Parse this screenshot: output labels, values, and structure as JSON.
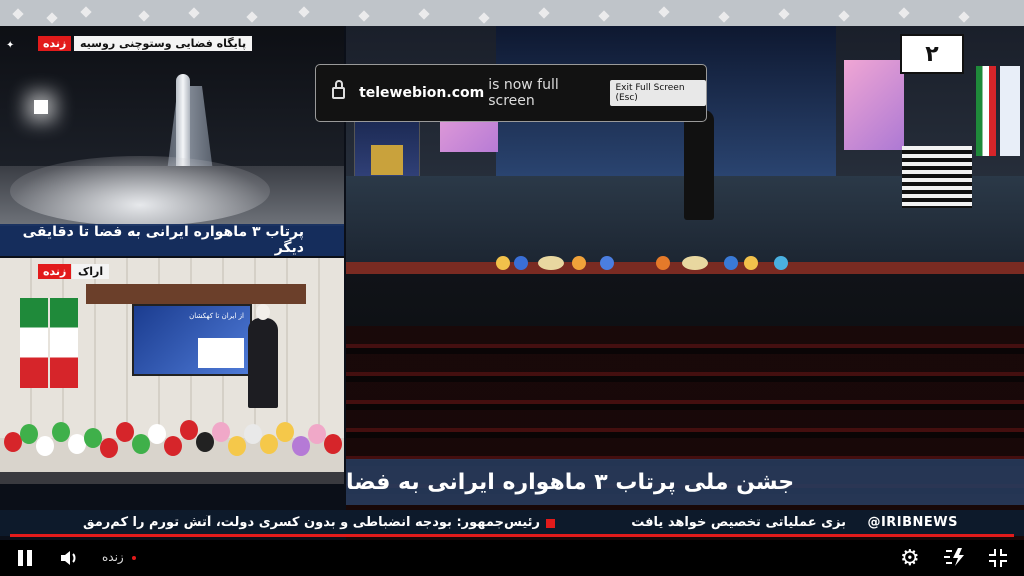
{
  "fullscreen_toast": {
    "domain": "telewebion.com",
    "message": "is now full screen",
    "exit_label": "Exit Full Screen (Esc)"
  },
  "panel_top": {
    "location_label": "پایگاه فضایی وستوچنی روسیه",
    "live_label": "زنده",
    "caption": "پرتاب ۳ ماهواره ایرانی به فضا تا دقایقی دیگر"
  },
  "panel_bottom": {
    "location_label": "اراک",
    "live_label": "زنده",
    "screen_text": "از ایران تا کهکشان"
  },
  "channel_logo": "۲",
  "lower_third": "جشن ملی پرتاب ۳ ماهواره ایرانی به فضا",
  "ticker": {
    "brand": "@IRIBNEWS",
    "item1": "بزی عملیاتی تخصیص خواهد یافت",
    "item2": "رئیس‌جمهور: بودجه انضباطی و بدون کسری دولت، آتش تورم را کم‌رمق"
  },
  "player": {
    "live_label": "زنده",
    "icons": [
      "pause-icon",
      "volume-icon",
      "gear-icon",
      "playback-speed-icon",
      "exit-fullscreen-icon"
    ]
  },
  "colors": {
    "accent_red": "#e21b1b",
    "caption_blue": "#142e60",
    "ticker_bg": "#0d1a2b"
  }
}
